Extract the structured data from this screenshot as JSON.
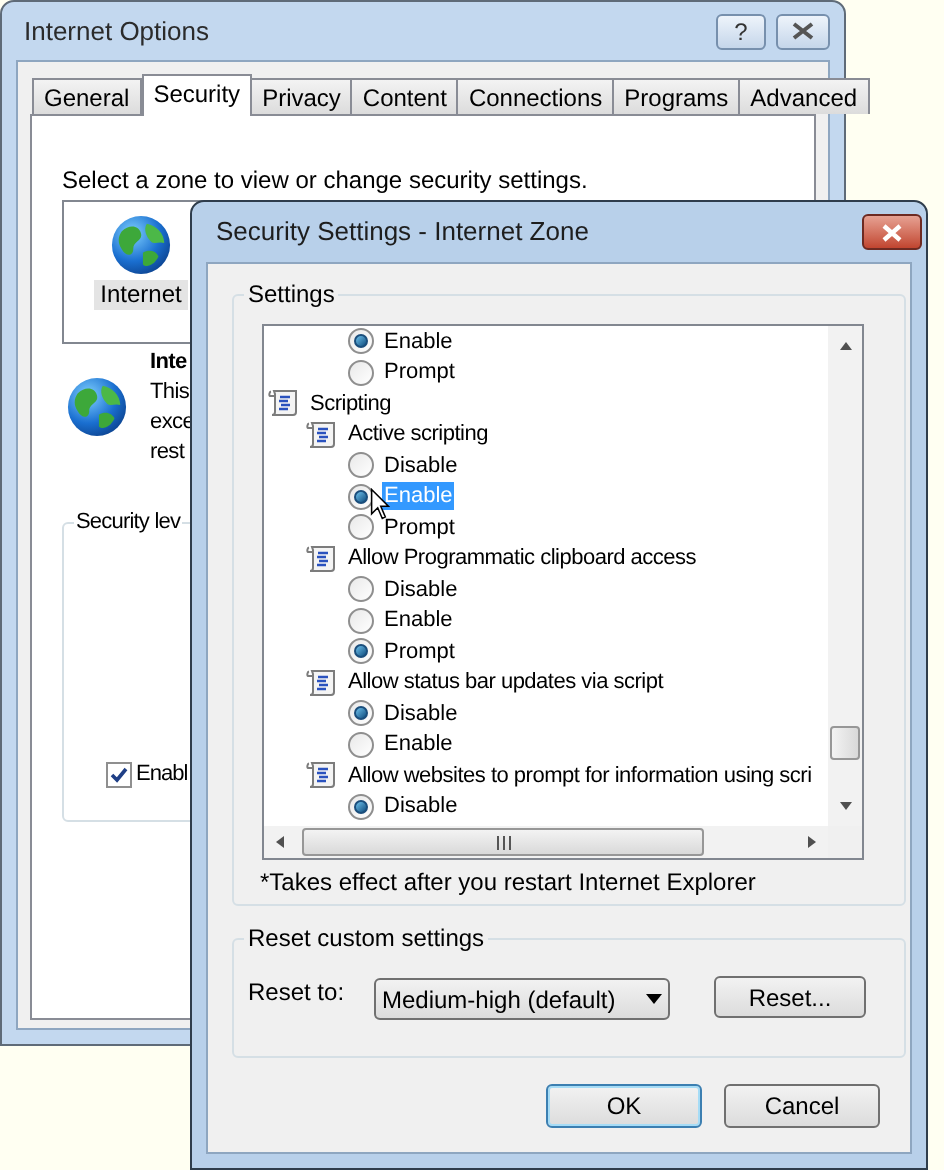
{
  "background_window": {
    "title": "Internet Options",
    "help_button": "?",
    "tabs": [
      {
        "label": "General",
        "selected": false
      },
      {
        "label": "Security",
        "selected": true
      },
      {
        "label": "Privacy",
        "selected": false
      },
      {
        "label": "Content",
        "selected": false
      },
      {
        "label": "Connections",
        "selected": false
      },
      {
        "label": "Programs",
        "selected": false
      },
      {
        "label": "Advanced",
        "selected": false
      }
    ],
    "zone_prompt": "Select a zone to view or change security settings.",
    "zones": [
      {
        "label": "Internet",
        "selected": true
      }
    ],
    "zone_heading": "Inte",
    "zone_description": [
      "This",
      "exce",
      "rest"
    ],
    "security_level_label": "Security lev",
    "protected_mode": {
      "label": "Enabl",
      "checked": true
    }
  },
  "dialog": {
    "title": "Security Settings - Internet Zone",
    "settings_label": "Settings",
    "tree": [
      {
        "kind": "group",
        "children": [
          {
            "kind": "setting",
            "children": [
              {
                "kind": "radio",
                "label": "Enable",
                "selected": true,
                "highlighted": false
              },
              {
                "kind": "radio",
                "label": "Prompt",
                "selected": false,
                "highlighted": false
              }
            ]
          }
        ]
      },
      {
        "kind": "group",
        "label": "Scripting",
        "children": [
          {
            "kind": "setting",
            "label": "Active scripting",
            "children": [
              {
                "kind": "radio",
                "label": "Disable",
                "selected": false,
                "highlighted": false
              },
              {
                "kind": "radio",
                "label": "Enable",
                "selected": true,
                "highlighted": true
              },
              {
                "kind": "radio",
                "label": "Prompt",
                "selected": false,
                "highlighted": false
              }
            ]
          },
          {
            "kind": "setting",
            "label": "Allow Programmatic clipboard access",
            "children": [
              {
                "kind": "radio",
                "label": "Disable",
                "selected": false,
                "highlighted": false
              },
              {
                "kind": "radio",
                "label": "Enable",
                "selected": false,
                "highlighted": false
              },
              {
                "kind": "radio",
                "label": "Prompt",
                "selected": true,
                "highlighted": false
              }
            ]
          },
          {
            "kind": "setting",
            "label": "Allow status bar updates via script",
            "children": [
              {
                "kind": "radio",
                "label": "Disable",
                "selected": true,
                "highlighted": false
              },
              {
                "kind": "radio",
                "label": "Enable",
                "selected": false,
                "highlighted": false
              }
            ]
          },
          {
            "kind": "setting",
            "label": "Allow websites to prompt for information using scri",
            "children": [
              {
                "kind": "radio",
                "label": "Disable",
                "selected": true,
                "highlighted": false
              }
            ]
          }
        ]
      }
    ],
    "note": "*Takes effect after you restart Internet Explorer",
    "reset_group": {
      "label": "Reset custom settings",
      "reset_to_label": "Reset to:",
      "dropdown_value": "Medium-high (default)",
      "reset_button": "Reset..."
    },
    "buttons": [
      {
        "label": "OK",
        "default": true
      },
      {
        "label": "Cancel",
        "default": false
      }
    ]
  }
}
